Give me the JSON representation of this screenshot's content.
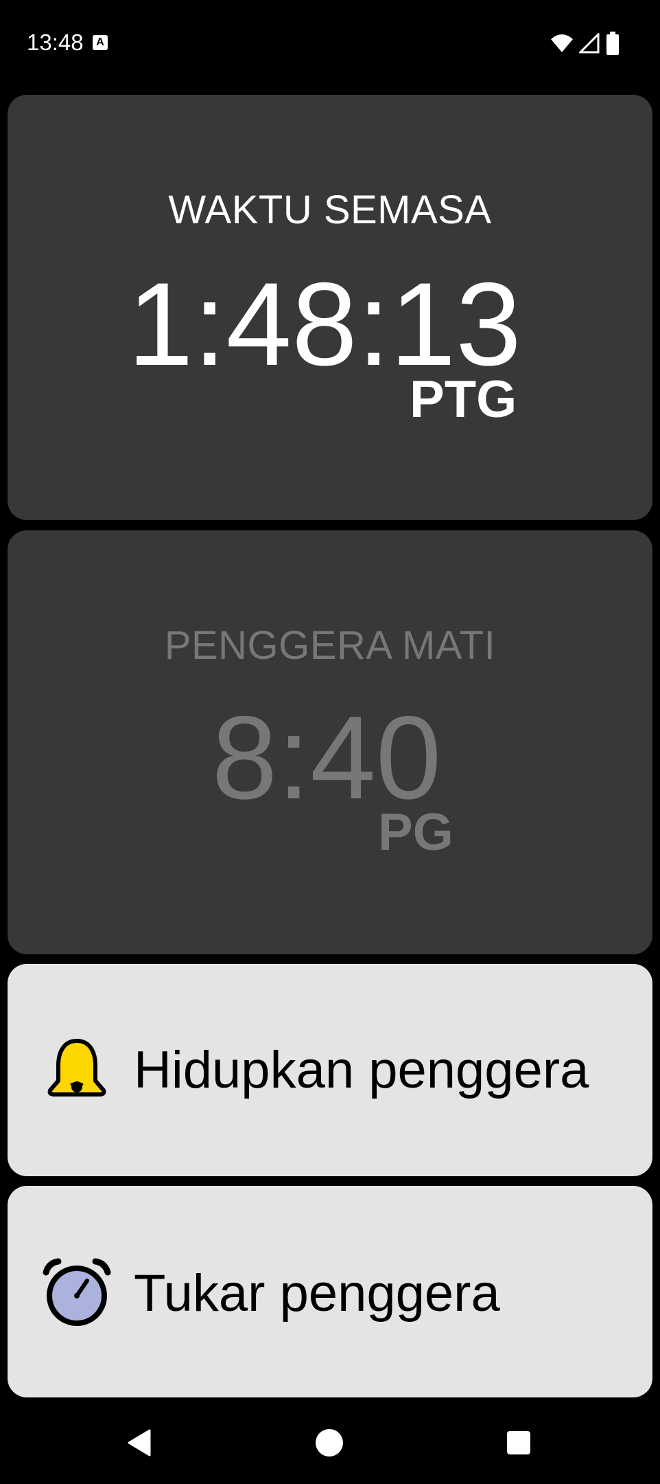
{
  "status_bar": {
    "time": "13:48",
    "notification_icon": "a-icon",
    "icons": [
      "wifi-icon",
      "cell-signal-icon",
      "battery-icon"
    ]
  },
  "current_time_card": {
    "label": "WAKTU SEMASA",
    "time": "1:48:13",
    "ampm": "PTG"
  },
  "alarm_card": {
    "label": "PENGGERA MATI",
    "time": "8:40",
    "ampm": "PG"
  },
  "actions": {
    "enable_alarm": {
      "label": "Hidupkan penggera",
      "icon": "bell-icon",
      "icon_color": "#FFD700"
    },
    "change_alarm": {
      "label": "Tukar penggera",
      "icon": "alarm-clock-icon",
      "icon_color": "#AAB2DD"
    }
  },
  "nav_bar": {
    "icons": [
      "back-icon",
      "home-icon",
      "recents-icon"
    ]
  },
  "colors": {
    "background": "#000000",
    "card_dark": "#383838",
    "card_light": "#E4E4E4",
    "text_primary": "#FFFFFF",
    "text_disabled": "#777777"
  }
}
